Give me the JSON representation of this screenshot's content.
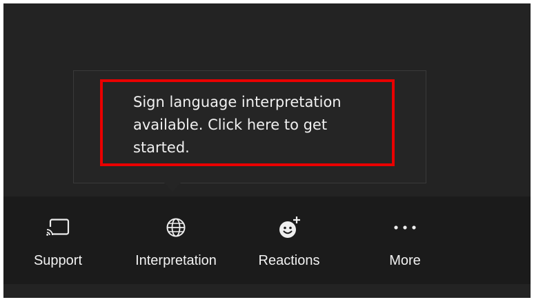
{
  "tooltip": {
    "message": "Sign language interpretation available. Click here to get started."
  },
  "toolbar": {
    "items": [
      {
        "label": "Support",
        "icon": "cast-screen-icon"
      },
      {
        "label": "Interpretation",
        "icon": "globe-icon"
      },
      {
        "label": "Reactions",
        "icon": "smiley-add-icon"
      },
      {
        "label": "More",
        "icon": "more-ellipsis-icon"
      }
    ]
  },
  "colors": {
    "background": "#232323",
    "toolbar_background": "#1b1b1b",
    "highlight_border": "#e90000",
    "text": "#f2f2f2"
  }
}
